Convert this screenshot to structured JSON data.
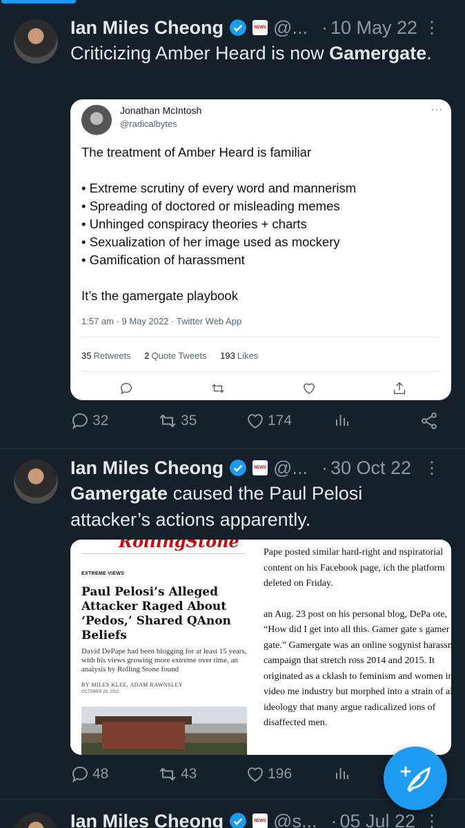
{
  "tweets": [
    {
      "name": "Ian Miles Cheong",
      "handle": "@...",
      "date": "10 May 22",
      "text_parts": [
        "Criticizing Amber Heard is now ",
        "Gamergate",
        "."
      ],
      "quote": {
        "name": "Jonathan McIntosh",
        "handle": "@radicalbytes",
        "more": "···",
        "lines": [
          "The treatment of Amber Heard is familiar",
          "",
          "• Extreme scrutiny of every word and mannerism",
          "• Spreading of doctored or misleading memes",
          "• Unhinged conspiracy theories + charts",
          "• Sexualization of her image used as mockery",
          "• Gamification of harassment",
          "",
          "It’s the gamergate playbook"
        ],
        "meta": "1:57 am · 9 May 2022 · Twitter Web App",
        "stats": [
          {
            "count": "35",
            "label": "Retweets"
          },
          {
            "count": "2",
            "label": "Quote Tweets"
          },
          {
            "count": "193",
            "label": "Likes"
          }
        ]
      },
      "actions": {
        "replies": "32",
        "retweets": "35",
        "likes": "174"
      }
    },
    {
      "name": "Ian Miles Cheong",
      "handle": "@...",
      "date": "30 Oct 22",
      "text_parts": [
        "Gamergate",
        " caused the Paul Pelosi attacker’s actions apparently."
      ],
      "article": {
        "logo": "RollingStone",
        "kicker": "EXTREME VIEWS",
        "headline": "Paul Pelosi’s Alleged Attacker Raged About ‘Pedos,’ Shared QAnon Beliefs",
        "dek": "David DePape had been blogging for at least 15 years, with his views growing more extreme over time, an analysis by Rolling Stone found",
        "byline": "BY MILES KLEE, ADAM RAWNSLEY",
        "date": "OCTOBER 28, 2022",
        "right_p1": "Pape posted similar hard-right and nspiratorial content on his Facebook page, ich the platform deleted on Friday.",
        "right_p2": "an Aug. 23 post on his personal blog, DePa ote, “How did I get into all this. Gamer gate s gamer gate.” Gamergate was an online sogynist harassment campaign that stretch ross 2014 and 2015. It originated as a cklash to feminism and women in the video me industry but morphed into a strain of al ht ideology that many argue radicalized ions of disaffected men."
      },
      "actions": {
        "replies": "48",
        "retweets": "43",
        "likes": "196"
      }
    },
    {
      "name": "Ian Miles Cheong",
      "handle": "@s...",
      "date": "05 Jul 22"
    }
  ],
  "colors": {
    "background": "#15202b",
    "accent": "#1d9bf0",
    "text": "#e7e9ea",
    "muted": "#8b98a5"
  }
}
